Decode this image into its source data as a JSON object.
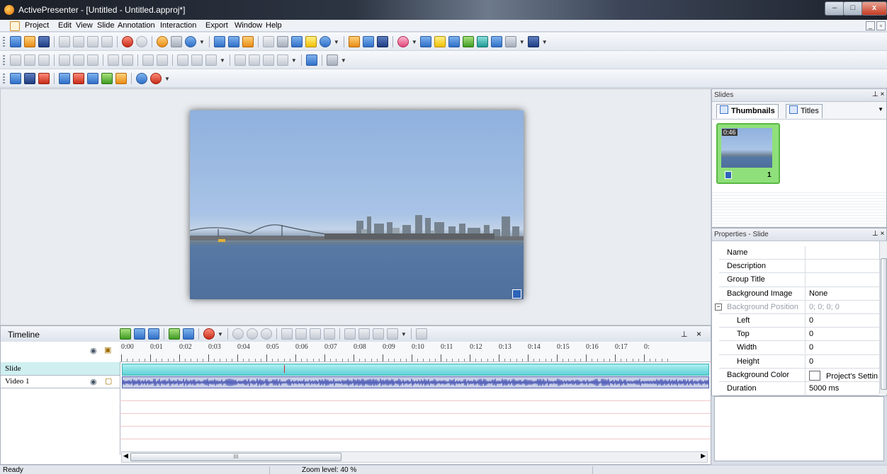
{
  "window": {
    "title": "ActivePresenter - [Untitled - Untitled.approj*]",
    "min_glyph": "–",
    "max_glyph": "□",
    "close_glyph": "x"
  },
  "menu": {
    "items": [
      "Project",
      "Edit",
      "View",
      "Slide",
      "Annotation",
      "Interaction",
      "Export",
      "Window",
      "Help"
    ],
    "mdi_min": "_",
    "mdi_restore": "▫"
  },
  "slides_panel": {
    "title": "Slides",
    "pin": "⊥ ×",
    "tabs": [
      "Thumbnails",
      "Titles"
    ],
    "tabs_dropdown": "▼",
    "thumbnail": {
      "duration": "0:46",
      "number": "1"
    }
  },
  "properties_panel": {
    "title": "Properties - Slide",
    "pin": "⊥ ×",
    "rows": [
      {
        "name": "Name",
        "value": ""
      },
      {
        "name": "Description",
        "value": ""
      },
      {
        "name": "Group Title",
        "value": ""
      },
      {
        "name": "Background Image",
        "value": "None"
      },
      {
        "name": "Background Position",
        "value": "0; 0; 0; 0"
      },
      {
        "name": "Left",
        "value": "0"
      },
      {
        "name": "Top",
        "value": "0"
      },
      {
        "name": "Width",
        "value": "0"
      },
      {
        "name": "Height",
        "value": "0"
      },
      {
        "name": "Background Color",
        "value": "Project's Settin"
      },
      {
        "name": "Duration",
        "value": "5000 ms"
      }
    ],
    "expander_glyph": "−"
  },
  "timeline": {
    "title": "Timeline",
    "pin": "⊥",
    "close": "×",
    "ruler": [
      "0:00",
      "0:01",
      "0:02",
      "0:03",
      "0:04",
      "0:05",
      "0:06",
      "0:07",
      "0:08",
      "0:09",
      "0:10",
      "0:11",
      "0:12",
      "0:13",
      "0:14",
      "0:15",
      "0:16",
      "0:17",
      "0:"
    ],
    "tracks": [
      "Slide",
      "Video 1"
    ],
    "scroll_grip": "III"
  },
  "status": {
    "ready": "Ready",
    "zoom": "Zoom level: 40 %"
  },
  "colors": {
    "thumbnail_border": "#59b844",
    "slide_track": "#5fd0d6",
    "playhead": "#e02020",
    "video_waveform": "#3b4ab0"
  }
}
